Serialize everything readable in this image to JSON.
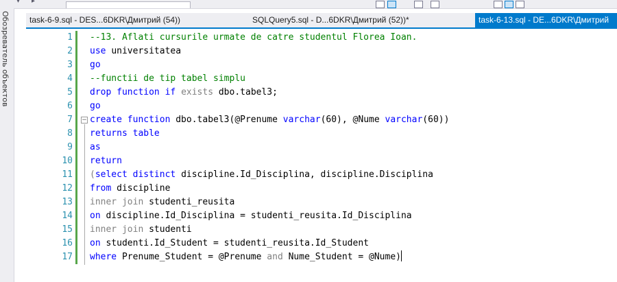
{
  "side_panel": {
    "label": "Обозреватель объектов"
  },
  "tabs": [
    {
      "label": "task-6-9.sql - DES...6DKR\\Дмитрий (54))",
      "active": false
    },
    {
      "label": "SQLQuery5.sql - D...6DKR\\Дмитрий (52))*",
      "active": false
    },
    {
      "label": "task-6-13.sql - DE...6DKR\\Дмитрий",
      "active": true
    }
  ],
  "editor": {
    "lines": [
      {
        "num": "1",
        "tokens": [
          {
            "t": "--13. Aflati cursurile urmate de catre studentul Florea Ioan.",
            "c": "cm"
          }
        ]
      },
      {
        "num": "2",
        "tokens": [
          {
            "t": "use ",
            "c": "kw"
          },
          {
            "t": "universitatea",
            "c": "id"
          }
        ]
      },
      {
        "num": "3",
        "tokens": [
          {
            "t": "go",
            "c": "kw"
          }
        ]
      },
      {
        "num": "4",
        "tokens": [
          {
            "t": "--functii de tip tabel simplu",
            "c": "cm"
          }
        ]
      },
      {
        "num": "5",
        "tokens": [
          {
            "t": "drop function if ",
            "c": "kw"
          },
          {
            "t": "exists ",
            "c": "gr"
          },
          {
            "t": "dbo.tabel3;",
            "c": "id"
          }
        ]
      },
      {
        "num": "6",
        "tokens": [
          {
            "t": "go",
            "c": "kw"
          }
        ]
      },
      {
        "num": "7",
        "tokens": [
          {
            "t": "create function ",
            "c": "kw"
          },
          {
            "t": "dbo.tabel3(@Prenume ",
            "c": "id"
          },
          {
            "t": "varchar",
            "c": "kw"
          },
          {
            "t": "(60), @Nume ",
            "c": "id"
          },
          {
            "t": "varchar",
            "c": "kw"
          },
          {
            "t": "(60))",
            "c": "id"
          }
        ]
      },
      {
        "num": "8",
        "tokens": [
          {
            "t": "returns table",
            "c": "kw"
          }
        ]
      },
      {
        "num": "9",
        "tokens": [
          {
            "t": "as",
            "c": "kw"
          }
        ]
      },
      {
        "num": "10",
        "tokens": [
          {
            "t": "return",
            "c": "kw"
          }
        ]
      },
      {
        "num": "11",
        "tokens": [
          {
            "t": "(",
            "c": "gr"
          },
          {
            "t": "select distinct ",
            "c": "kw"
          },
          {
            "t": "discipline.Id_Disciplina, discipline.Disciplina",
            "c": "id"
          }
        ]
      },
      {
        "num": "12",
        "tokens": [
          {
            "t": "from ",
            "c": "kw"
          },
          {
            "t": "discipline",
            "c": "id"
          }
        ]
      },
      {
        "num": "13",
        "tokens": [
          {
            "t": "inner join ",
            "c": "gr"
          },
          {
            "t": "studenti_reusita",
            "c": "id"
          }
        ]
      },
      {
        "num": "14",
        "tokens": [
          {
            "t": "on ",
            "c": "kw"
          },
          {
            "t": "discipline.Id_Disciplina = studenti_reusita.Id_Disciplina",
            "c": "id"
          }
        ]
      },
      {
        "num": "15",
        "tokens": [
          {
            "t": "inner join ",
            "c": "gr"
          },
          {
            "t": "studenti",
            "c": "id"
          }
        ]
      },
      {
        "num": "16",
        "tokens": [
          {
            "t": "on ",
            "c": "kw"
          },
          {
            "t": "studenti.Id_Student = studenti_reusita.Id_Student",
            "c": "id"
          }
        ]
      },
      {
        "num": "17",
        "tokens": [
          {
            "t": "where ",
            "c": "kw"
          },
          {
            "t": "Prenume_Student = @Prenume ",
            "c": "id"
          },
          {
            "t": "and ",
            "c": "gr"
          },
          {
            "t": "Nume_Student = @Nume)",
            "c": "id"
          }
        ]
      }
    ]
  }
}
